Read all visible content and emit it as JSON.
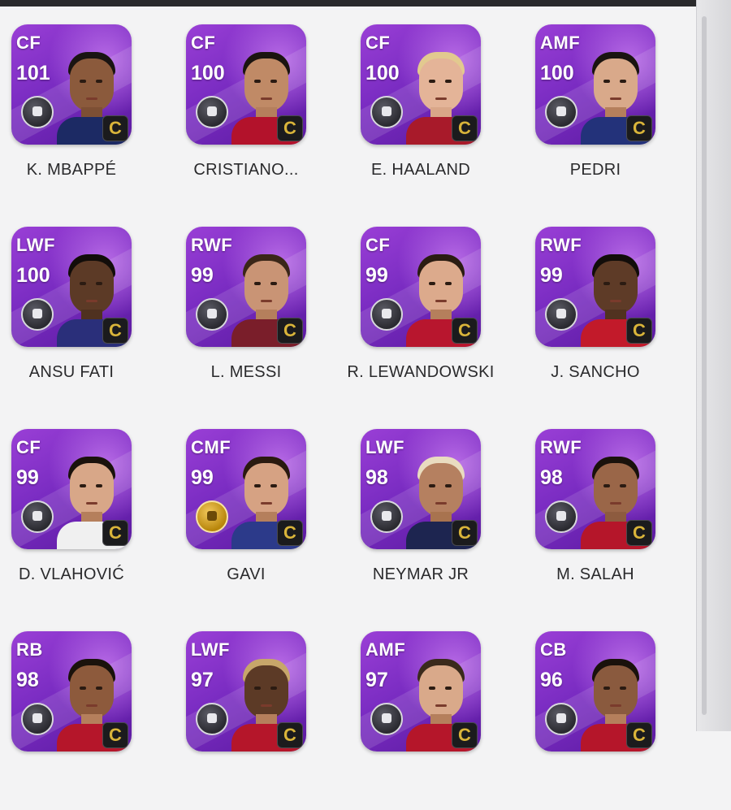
{
  "players": [
    {
      "position": "CF",
      "rating": "101",
      "name": "K. MBAPPÉ",
      "special": "C"
    },
    {
      "position": "CF",
      "rating": "100",
      "name": "CRISTIANO...",
      "special": "C"
    },
    {
      "position": "CF",
      "rating": "100",
      "name": "E. HAALAND",
      "special": "C"
    },
    {
      "position": "AMF",
      "rating": "100",
      "name": "PEDRI",
      "special": "C"
    },
    {
      "position": "LWF",
      "rating": "100",
      "name": "ANSU FATI",
      "special": "C"
    },
    {
      "position": "RWF",
      "rating": "99",
      "name": "L. MESSI",
      "special": "C"
    },
    {
      "position": "CF",
      "rating": "99",
      "name": "R. LEWANDOWSKI",
      "special": "C"
    },
    {
      "position": "RWF",
      "rating": "99",
      "name": "J. SANCHO",
      "special": "C"
    },
    {
      "position": "CF",
      "rating": "99",
      "name": "D. VLAHOVIĆ",
      "special": "C"
    },
    {
      "position": "CMF",
      "rating": "99",
      "name": "GAVI",
      "special": "C"
    },
    {
      "position": "LWF",
      "rating": "98",
      "name": "NEYMAR JR",
      "special": "C"
    },
    {
      "position": "RWF",
      "rating": "98",
      "name": "M. SALAH",
      "special": "C"
    },
    {
      "position": "RB",
      "rating": "98",
      "name": "",
      "special": "C"
    },
    {
      "position": "LWF",
      "rating": "97",
      "name": "",
      "special": "C"
    },
    {
      "position": "AMF",
      "rating": "97",
      "name": "",
      "special": "C"
    },
    {
      "position": "CB",
      "rating": "96",
      "name": "",
      "special": "C"
    }
  ],
  "colors": {
    "card_purple": "#8a35cc",
    "card_dark": "#5b1aa0",
    "c_badge_gold": "#d9b43a",
    "background": "#f3f3f4"
  },
  "icons": {
    "player_badge": "skill-badge-icon",
    "gold_badge": "gold-skill-badge-icon"
  }
}
